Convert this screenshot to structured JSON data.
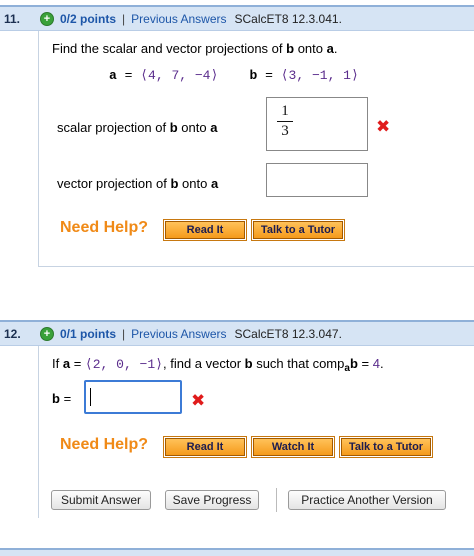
{
  "q11": {
    "number": "11.",
    "points": "0/2 points",
    "previous": "Previous Answers",
    "source": "SCalcET8 12.3.041.",
    "instruction_pre": "Find the scalar and vector projections of ",
    "instruction_b": "b",
    "instruction_mid": " onto ",
    "instruction_a": "a",
    "instruction_end": ".",
    "vec_a_label": "a",
    "vec_a_value": "⟨4, 7, −4⟩",
    "vec_b_label": "b",
    "vec_b_value": "⟨3, −1, 1⟩",
    "scalar_label_pre": "scalar projection of ",
    "scalar_label_b": "b",
    "scalar_label_mid": " onto ",
    "scalar_label_a": "a",
    "scalar_numerator": "1",
    "scalar_denominator": "3",
    "vector_label_pre": "vector projection of ",
    "vector_label_b": "b",
    "vector_label_mid": " onto ",
    "vector_label_a": "a",
    "vector_value": "",
    "need_help": "Need Help?",
    "read_it": "Read It",
    "talk_tutor": "Talk to a Tutor"
  },
  "q12": {
    "number": "12.",
    "points": "0/1 points",
    "previous": "Previous Answers",
    "source": "SCalcET8 12.3.047.",
    "if": "If ",
    "a_label": "a",
    "eq": " = ",
    "a_value": "⟨2, 0, −1⟩",
    "find_text": ", find a vector ",
    "b_label": "b",
    "such": " such that comp",
    "comp_sub": "a",
    "comp_b": "b",
    "eq_val": " = ",
    "value": "4",
    "period": ".",
    "b_field_label": "b",
    "b_field_eq": " = ",
    "b_value": "",
    "need_help": "Need Help?",
    "read_it": "Read It",
    "watch_it": "Watch It",
    "talk_tutor": "Talk to a Tutor"
  },
  "footer": {
    "submit": "Submit Answer",
    "save": "Save Progress",
    "practice": "Practice Another Version"
  },
  "colors": {
    "header_bg": "#d6e4f4",
    "link": "#1d56a8",
    "help": "#f08a17",
    "error": "#e01b1b"
  }
}
